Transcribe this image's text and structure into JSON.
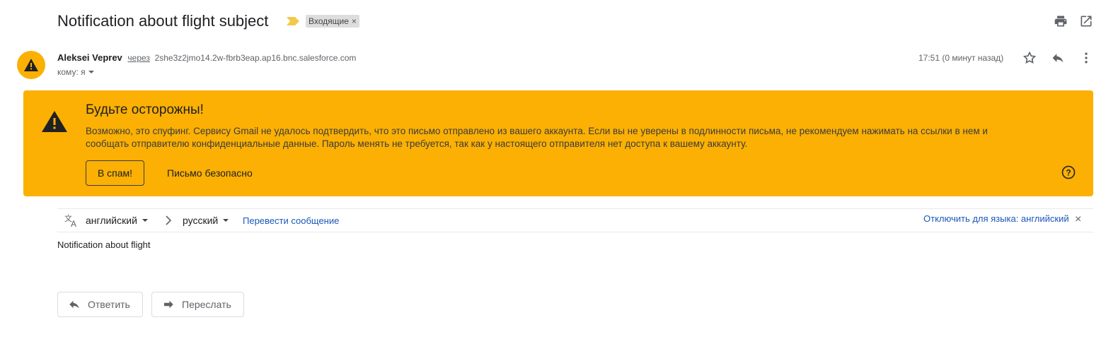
{
  "subject": {
    "title": "Notification about flight subject",
    "label": "Входящие",
    "label_remove": "×"
  },
  "sender": {
    "name": "Aleksei Veprev",
    "via_label": "через",
    "via_domain": "2she3z2jmo14.2w-fbrb3eap.ap16.bnc.salesforce.com",
    "to": "кому: я",
    "time": "17:51 (0 минут назад)"
  },
  "warning": {
    "title": "Будьте осторожны!",
    "text": "Возможно, это спуфинг. Сервису Gmail не удалось подтвердить, что это письмо отправлено из вашего аккаунта. Если вы не уверены в подлинности письма, не рекомендуем нажимать на ссылки в нем и сообщать отправителю конфиденциальные данные. Пароль менять не требуется, так как у настоящего отправителя нет доступа к вашему аккаунту.",
    "spam_button": "В спам!",
    "safe_button": "Письмо безопасно",
    "color": "#fbb003"
  },
  "translate": {
    "from_lang": "английский",
    "to_lang": "русский",
    "translate_link": "Перевести сообщение",
    "disable_link": "Отключить для языка: английский",
    "close": "×"
  },
  "body": {
    "text": "Notification about flight"
  },
  "actions": {
    "reply": "Ответить",
    "forward": "Переслать"
  },
  "icons": {
    "top": [
      "print-icon",
      "open-in-new-window-icon"
    ],
    "sender_row": [
      "star-icon",
      "reply-icon",
      "more-vert-icon"
    ]
  }
}
